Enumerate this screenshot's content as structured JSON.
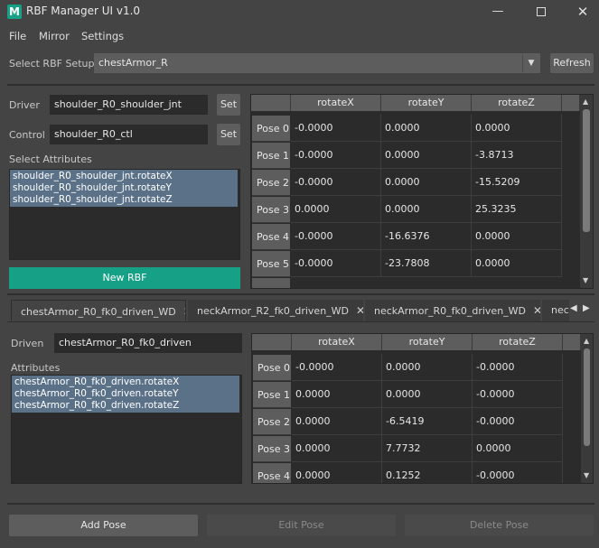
{
  "window": {
    "title": "RBF Manager UI v1.0",
    "logo_text": "M"
  },
  "menus": [
    "File",
    "Mirror",
    "Settings"
  ],
  "setup": {
    "label": "Select RBF Setup:",
    "value": "chestArmor_R",
    "refresh": "Refresh"
  },
  "driver": {
    "label": "Driver",
    "value": "shoulder_R0_shoulder_jnt",
    "set": "Set"
  },
  "control": {
    "label": "Control",
    "value": "shoulder_R0_ctl",
    "set": "Set"
  },
  "select_attributes": {
    "label": "Select Attributes",
    "items": [
      "shoulder_R0_shoulder_jnt.rotateX",
      "shoulder_R0_shoulder_jnt.rotateY",
      "shoulder_R0_shoulder_jnt.rotateZ"
    ]
  },
  "new_rbf": "New RBF",
  "driver_table": {
    "columns": [
      "rotateX",
      "rotateY",
      "rotateZ"
    ],
    "rows": [
      {
        "pose": "Pose 0",
        "values": [
          "-0.0000",
          "0.0000",
          "0.0000"
        ]
      },
      {
        "pose": "Pose 1",
        "values": [
          "-0.0000",
          "0.0000",
          "-3.8713"
        ]
      },
      {
        "pose": "Pose 2",
        "values": [
          "-0.0000",
          "0.0000",
          "-15.5209"
        ]
      },
      {
        "pose": "Pose 3",
        "values": [
          "0.0000",
          "0.0000",
          "25.3235"
        ]
      },
      {
        "pose": "Pose 4",
        "values": [
          "-0.0000",
          "-16.6376",
          "0.0000"
        ]
      },
      {
        "pose": "Pose 5",
        "values": [
          "-0.0000",
          "-23.7808",
          "0.0000"
        ]
      }
    ]
  },
  "tabs": [
    "chestArmor_R0_fk0_driven_WD",
    "neckArmor_R2_fk0_driven_WD",
    "neckArmor_R0_fk0_driven_WD",
    "nec"
  ],
  "driven": {
    "label": "Driven",
    "value": "chestArmor_R0_fk0_driven"
  },
  "attributes": {
    "label": "Attributes",
    "items": [
      "chestArmor_R0_fk0_driven.rotateX",
      "chestArmor_R0_fk0_driven.rotateY",
      "chestArmor_R0_fk0_driven.rotateZ"
    ]
  },
  "driven_table": {
    "columns": [
      "rotateX",
      "rotateY",
      "rotateZ"
    ],
    "rows": [
      {
        "pose": "Pose 0",
        "values": [
          "-0.0000",
          "0.0000",
          "-0.0000"
        ]
      },
      {
        "pose": "Pose 1",
        "values": [
          "0.0000",
          "0.0000",
          "-0.0000"
        ]
      },
      {
        "pose": "Pose 2",
        "values": [
          "0.0000",
          "-6.5419",
          "-0.0000"
        ]
      },
      {
        "pose": "Pose 3",
        "values": [
          "0.0000",
          "7.7732",
          "0.0000"
        ]
      },
      {
        "pose": "Pose 4",
        "values": [
          "0.0000",
          "0.1252",
          "-0.0000"
        ]
      }
    ]
  },
  "actions": {
    "add": "Add Pose",
    "edit": "Edit Pose",
    "delete": "Delete Pose"
  },
  "colors": {
    "accent": "#16a085",
    "selection": "#5b7188",
    "background": "#444444"
  }
}
